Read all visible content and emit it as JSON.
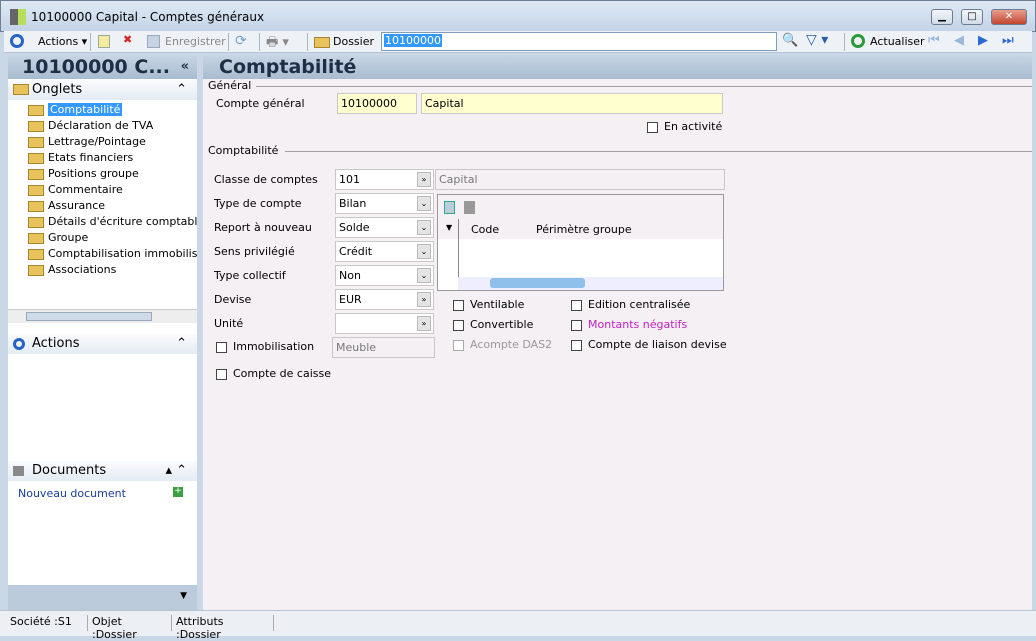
{
  "window": {
    "title": "10100000 Capital -  Comptes généraux",
    "minimize": "▁",
    "maximize": "□",
    "close": "✕"
  },
  "toolbar": {
    "actions": "Actions",
    "save": "Enregistrer",
    "folder": "Dossier",
    "search_value": "10100000",
    "refresh": "Actualiser"
  },
  "left": {
    "title": "10100000 C...",
    "collapse": "«",
    "tabs_header": "Onglets",
    "tabs": [
      "Comptabilité",
      "Déclaration de TVA",
      "Lettrage/Pointage",
      "Etats financiers",
      "Positions groupe",
      "Commentaire",
      "Assurance",
      "Détails d'écriture comptable",
      "Groupe",
      "Comptabilisation immobilisations",
      "Associations"
    ],
    "actions_header": "Actions",
    "documents_header": "Documents",
    "new_document": "Nouveau document"
  },
  "main": {
    "title": "Comptabilité",
    "general": {
      "legend": "Général",
      "account_label": "Compte général",
      "account_value": "10100000",
      "account_name": "Capital",
      "active_label": "En activité"
    },
    "accounting": {
      "legend": "Comptabilité",
      "fields": [
        {
          "label": "Classe de comptes",
          "value": "101"
        },
        {
          "label": "Type de compte",
          "value": "Bilan"
        },
        {
          "label": "Report à nouveau",
          "value": "Solde"
        },
        {
          "label": "Sens privilégié",
          "value": "Crédit"
        },
        {
          "label": "Type collectif",
          "value": "Non"
        },
        {
          "label": "Devise",
          "value": "EUR"
        },
        {
          "label": "Unité",
          "value": ""
        }
      ],
      "class_desc": "Capital",
      "immobilisation": "Immobilisation",
      "immobilisation_value": "Meuble",
      "cash": "Compte de caisse",
      "grid_cols": [
        "Code",
        "Périmètre groupe"
      ],
      "checks": [
        "Ventilable",
        "Convertible",
        "Acompte DAS2",
        "Edition centralisée",
        "Montants négatifs",
        "Compte de liaison devise"
      ]
    }
  },
  "status": {
    "company": "Société :S1",
    "object": "Objet :Dossier",
    "attributes": "Attributs :Dossier"
  }
}
